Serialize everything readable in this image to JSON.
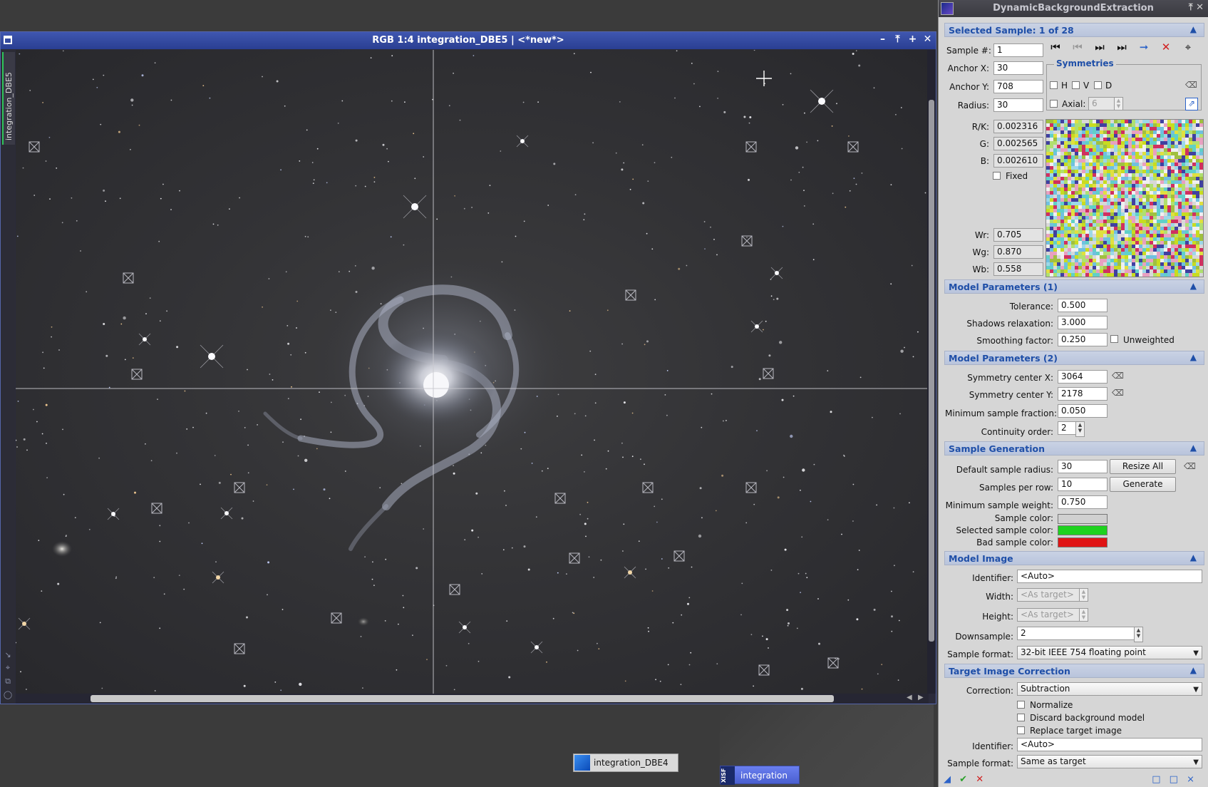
{
  "image_window": {
    "title": "RGB 1:4 integration_DBE5 | <*new*>",
    "side_tab_label": "integration_DBE5",
    "buttons": [
      "–",
      "⤒",
      "+",
      "✕"
    ]
  },
  "panel": {
    "title": "DynamicBackgroundExtraction",
    "title_buttons": "⤒ ✕",
    "selected_sample": {
      "header": "Selected Sample: 1 of 28",
      "sample_num_label": "Sample #:",
      "sample_num": "1",
      "anchor_x_label": "Anchor X:",
      "anchor_x": "30",
      "anchor_y_label": "Anchor Y:",
      "anchor_y": "708",
      "radius_label": "Radius:",
      "radius": "30",
      "rk_label": "R/K:",
      "rk": "0.002316",
      "g_label": "G:",
      "g": "0.002565",
      "b_label": "B:",
      "b": "0.002610",
      "fixed_label": "Fixed",
      "wr_label": "Wr:",
      "wr": "0.705",
      "wg_label": "Wg:",
      "wg": "0.870",
      "wb_label": "Wb:",
      "wb": "0.558",
      "symmetries": {
        "legend": "Symmetries",
        "h": "H",
        "v": "V",
        "d": "D",
        "axial_label": "Axial:",
        "axial_value": "6"
      }
    },
    "model_params_1": {
      "header": "Model Parameters (1)",
      "tolerance_label": "Tolerance:",
      "tolerance": "0.500",
      "shadows_label": "Shadows relaxation:",
      "shadows": "3.000",
      "smoothing_label": "Smoothing factor:",
      "smoothing": "0.250",
      "unweighted_label": "Unweighted"
    },
    "model_params_2": {
      "header": "Model Parameters (2)",
      "sym_x_label": "Symmetry center X:",
      "sym_x": "3064",
      "sym_y_label": "Symmetry center Y:",
      "sym_y": "2178",
      "min_frac_label": "Minimum sample fraction:",
      "min_frac": "0.050",
      "continuity_label": "Continuity order:",
      "continuity": "2"
    },
    "sample_generation": {
      "header": "Sample Generation",
      "default_radius_label": "Default sample radius:",
      "default_radius": "30",
      "resize_all": "Resize All",
      "per_row_label": "Samples per row:",
      "per_row": "10",
      "generate": "Generate",
      "min_weight_label": "Minimum sample weight:",
      "min_weight": "0.750",
      "sample_color_label": "Sample color:",
      "selected_color_label": "Selected sample color:",
      "bad_color_label": "Bad sample color:"
    },
    "model_image": {
      "header": "Model Image",
      "identifier_label": "Identifier:",
      "identifier": "<Auto>",
      "width_label": "Width:",
      "width": "<As target>",
      "height_label": "Height:",
      "height": "<As target>",
      "downsample_label": "Downsample:",
      "downsample": "2",
      "format_label": "Sample format:",
      "format": "32-bit IEEE 754 floating point"
    },
    "target_correction": {
      "header": "Target Image Correction",
      "correction_label": "Correction:",
      "correction": "Subtraction",
      "normalize_label": "Normalize",
      "discard_label": "Discard background model",
      "replace_label": "Replace target image",
      "identifier_label": "Identifier:",
      "identifier": "<Auto>",
      "format_label": "Sample format:",
      "format": "Same as target"
    }
  },
  "minimized": {
    "icon1": "integration_DBE4",
    "icon2": "integration",
    "icon2_badge": "XISF"
  },
  "colors": {
    "sample_color": "#d0d0d0",
    "selected_sample_color": "#1ed21e",
    "bad_sample_color": "#e01414",
    "section_text": "#1f4fa8"
  }
}
